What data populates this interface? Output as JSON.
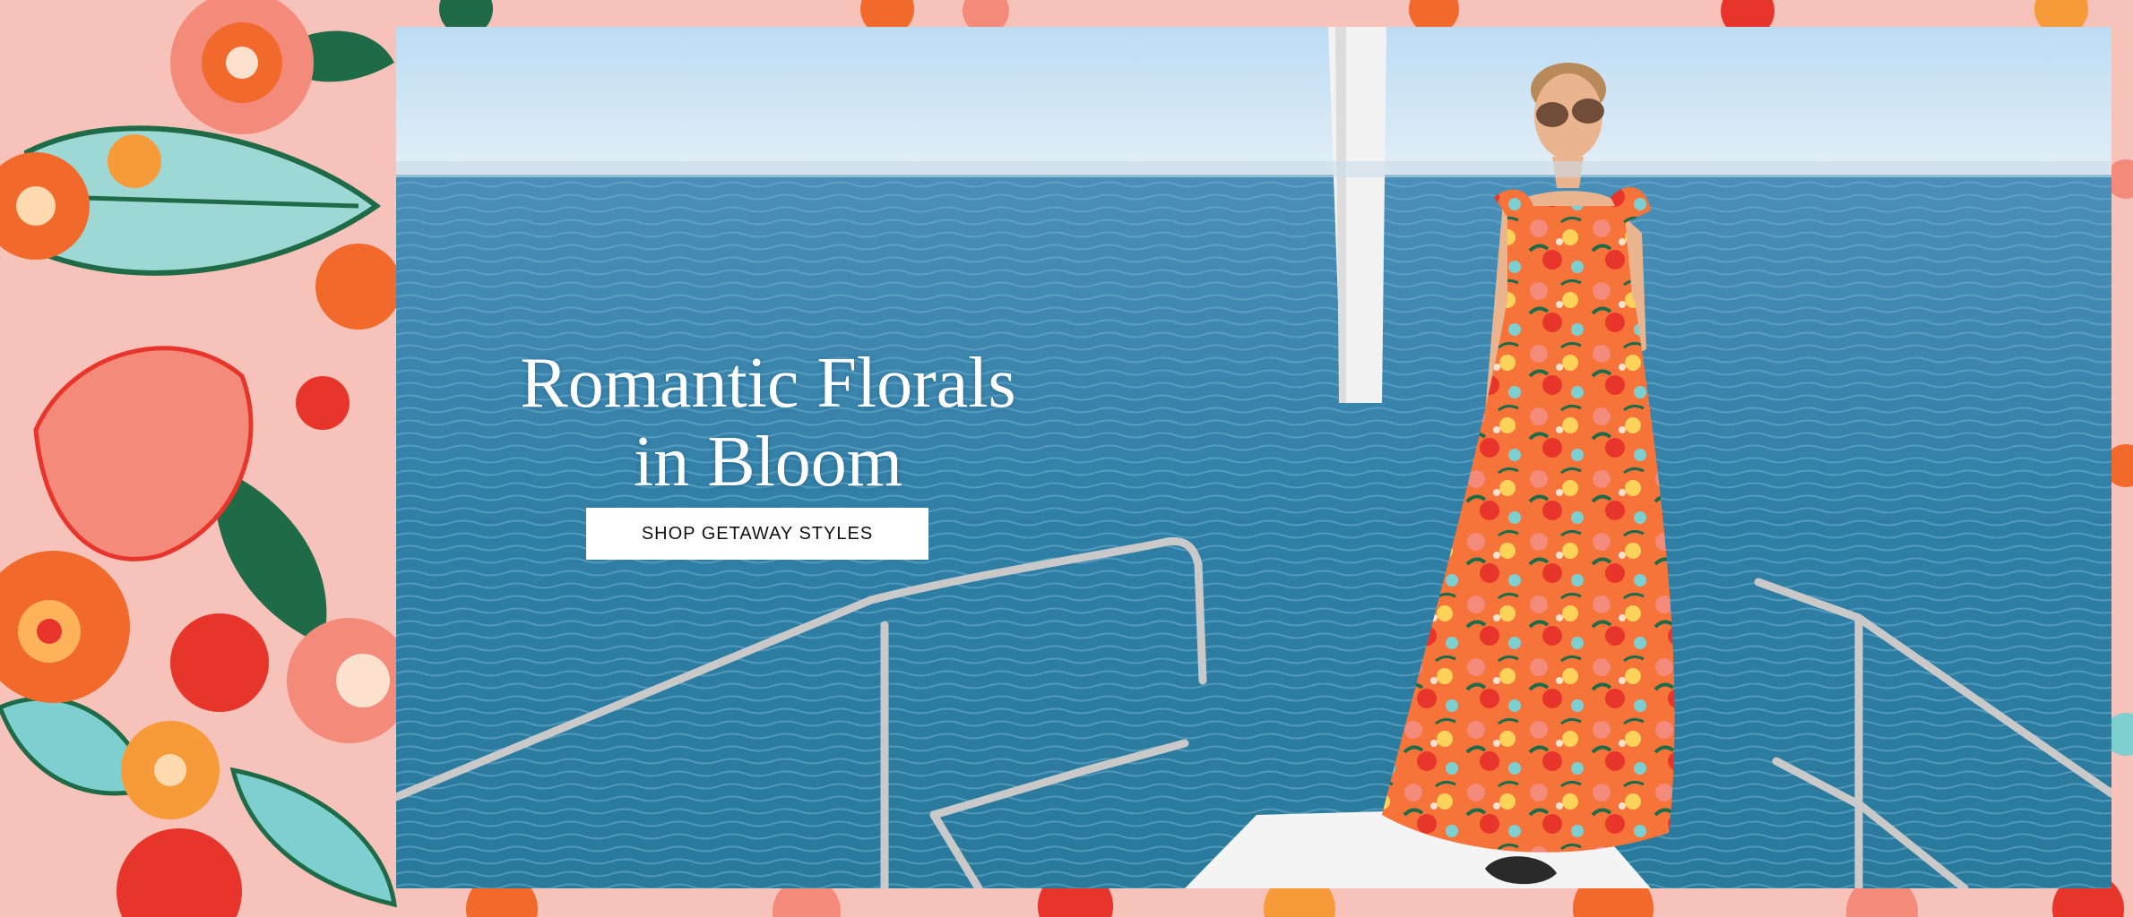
{
  "hero": {
    "headline_line1": "Romantic Florals",
    "headline_line2": "in Bloom",
    "cta_label": "SHOP GETAWAY STYLES"
  },
  "colors": {
    "pattern_base": "#f6b8b0",
    "flower_orange": "#f26a2b",
    "flower_red": "#e8352b",
    "flower_pink": "#f48a7a",
    "leaf_green": "#1f6b47",
    "leaf_aqua": "#7ecfd0",
    "sea": "#2e7ea3",
    "sky": "#cfe6f6",
    "button_bg": "#ffffff",
    "button_text": "#111111"
  }
}
